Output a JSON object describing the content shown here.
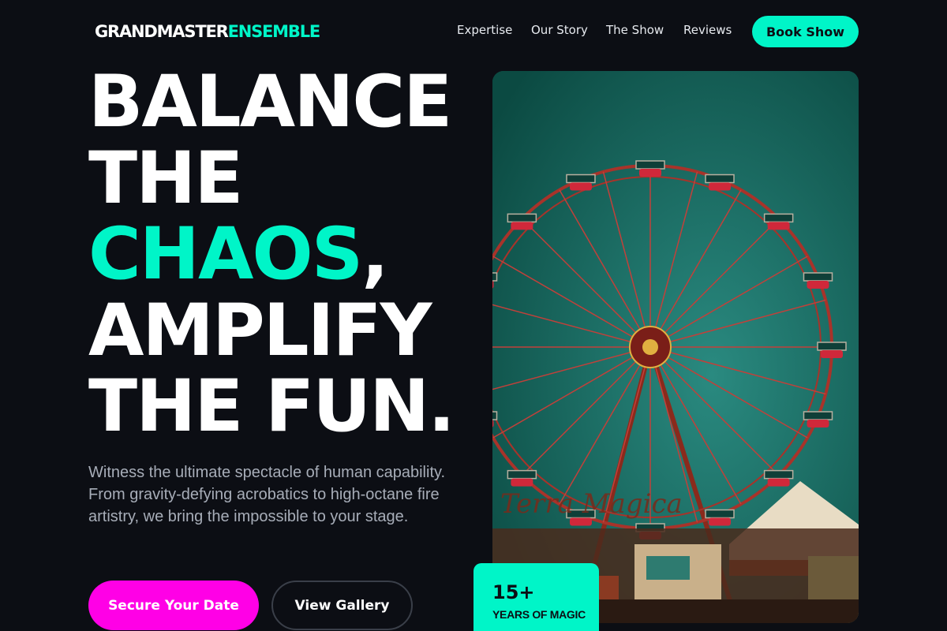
{
  "brand": {
    "logo_part1": "GRANDMASTER",
    "logo_part2": "ENSEMBLE",
    "accent_color": "#00f5c8",
    "cta_color": "#ff00e6",
    "background_color": "#0c0e14"
  },
  "nav": {
    "links": [
      "Expertise",
      "Our Story",
      "The Show",
      "Reviews"
    ],
    "cta_label": "Book Show"
  },
  "hero": {
    "headline": {
      "line1": "BALANCE",
      "line2": "THE",
      "line3_accent": "CHAOS",
      "line3_tail": ",",
      "line4": "AMPLIFY",
      "line5": "THE FUN."
    },
    "description": "Witness the ultimate spectacle of human capability. From gravity-defying acrobatics to high-octane fire artistry, we bring the impossible to your stage.",
    "primary_cta": "Secure Your Date",
    "secondary_cta": "View Gallery"
  },
  "image": {
    "subject": "ferris-wheel-carnival-photo"
  },
  "badge": {
    "number": "15+",
    "label": "YEARS OF MAGIC"
  }
}
